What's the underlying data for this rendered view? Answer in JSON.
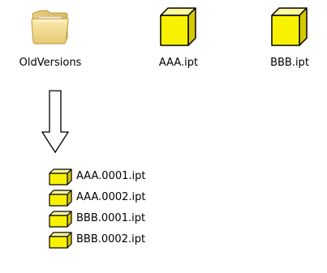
{
  "desktop_icons": [
    {
      "label": "OldVersions",
      "icon": "folder-icon"
    },
    {
      "label": "AAA.ipt",
      "icon": "part-file-icon"
    },
    {
      "label": "BBB.ipt",
      "icon": "part-file-icon"
    }
  ],
  "arrow": {
    "icon": "down-arrow-icon"
  },
  "folder_contents": [
    {
      "label": "AAA.0001.ipt",
      "icon": "part-file-icon"
    },
    {
      "label": "AAA.0002.ipt",
      "icon": "part-file-icon"
    },
    {
      "label": "BBB.0001.ipt",
      "icon": "part-file-icon"
    },
    {
      "label": "BBB.0002.ipt",
      "icon": "part-file-icon"
    }
  ],
  "colors": {
    "cube_face": "#f8f200",
    "cube_top": "#fffa9a",
    "cube_side": "#d6c800",
    "cube_outline": "#000000",
    "folder_body": "#f0d98a",
    "folder_outline": "#b89a43"
  }
}
